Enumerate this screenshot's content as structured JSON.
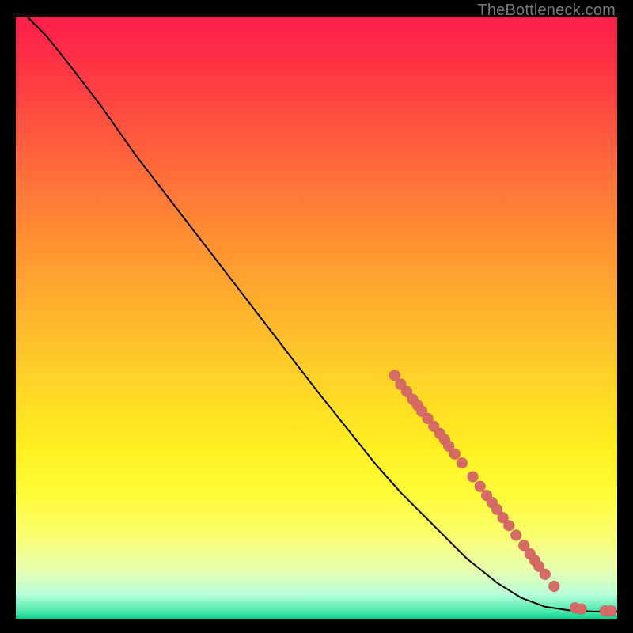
{
  "watermark": "TheBottleneck.com",
  "colors": {
    "dot": "#d86a65",
    "curve": "#000000",
    "frame": "#000000"
  },
  "chart_data": {
    "type": "line",
    "title": "",
    "xlabel": "",
    "ylabel": "",
    "xlim": [
      0,
      100
    ],
    "ylim": [
      0,
      100
    ],
    "grid": false,
    "legend": false,
    "series": [
      {
        "name": "bottleneck-curve",
        "points": [
          {
            "x": 2,
            "y": 100
          },
          {
            "x": 5,
            "y": 97
          },
          {
            "x": 9,
            "y": 92
          },
          {
            "x": 14,
            "y": 85.5
          },
          {
            "x": 20,
            "y": 77
          },
          {
            "x": 30,
            "y": 64
          },
          {
            "x": 40,
            "y": 51
          },
          {
            "x": 50,
            "y": 38
          },
          {
            "x": 60,
            "y": 25.5
          },
          {
            "x": 64,
            "y": 21
          },
          {
            "x": 70,
            "y": 15
          },
          {
            "x": 75,
            "y": 10
          },
          {
            "x": 80,
            "y": 6
          },
          {
            "x": 84,
            "y": 3.5
          },
          {
            "x": 88,
            "y": 2.0
          },
          {
            "x": 92,
            "y": 1.4
          },
          {
            "x": 96,
            "y": 1.2
          },
          {
            "x": 100,
            "y": 1.2
          }
        ]
      }
    ],
    "scatter": {
      "name": "highlighted-segment",
      "points": [
        {
          "x": 63.0,
          "y": 40.5
        },
        {
          "x": 64.0,
          "y": 39.0
        },
        {
          "x": 65.0,
          "y": 37.8
        },
        {
          "x": 66.0,
          "y": 36.5
        },
        {
          "x": 66.8,
          "y": 35.5
        },
        {
          "x": 67.5,
          "y": 34.5
        },
        {
          "x": 68.5,
          "y": 33.3
        },
        {
          "x": 69.5,
          "y": 32.0
        },
        {
          "x": 70.5,
          "y": 30.8
        },
        {
          "x": 71.3,
          "y": 29.8
        },
        {
          "x": 72.0,
          "y": 28.7
        },
        {
          "x": 73.0,
          "y": 27.4
        },
        {
          "x": 74.2,
          "y": 25.9
        },
        {
          "x": 76.0,
          "y": 23.6
        },
        {
          "x": 77.2,
          "y": 22.0
        },
        {
          "x": 78.3,
          "y": 20.5
        },
        {
          "x": 79.2,
          "y": 19.3
        },
        {
          "x": 80.0,
          "y": 18.2
        },
        {
          "x": 81.0,
          "y": 16.8
        },
        {
          "x": 82.0,
          "y": 15.5
        },
        {
          "x": 83.2,
          "y": 13.9
        },
        {
          "x": 84.5,
          "y": 12.2
        },
        {
          "x": 85.5,
          "y": 10.8
        },
        {
          "x": 86.3,
          "y": 9.7
        },
        {
          "x": 87.0,
          "y": 8.7
        },
        {
          "x": 88.0,
          "y": 7.4
        },
        {
          "x": 89.5,
          "y": 5.4
        },
        {
          "x": 93.0,
          "y": 1.8
        },
        {
          "x": 94.0,
          "y": 1.6
        },
        {
          "x": 98.0,
          "y": 1.3
        },
        {
          "x": 99.0,
          "y": 1.3
        }
      ],
      "radius": 7
    }
  }
}
